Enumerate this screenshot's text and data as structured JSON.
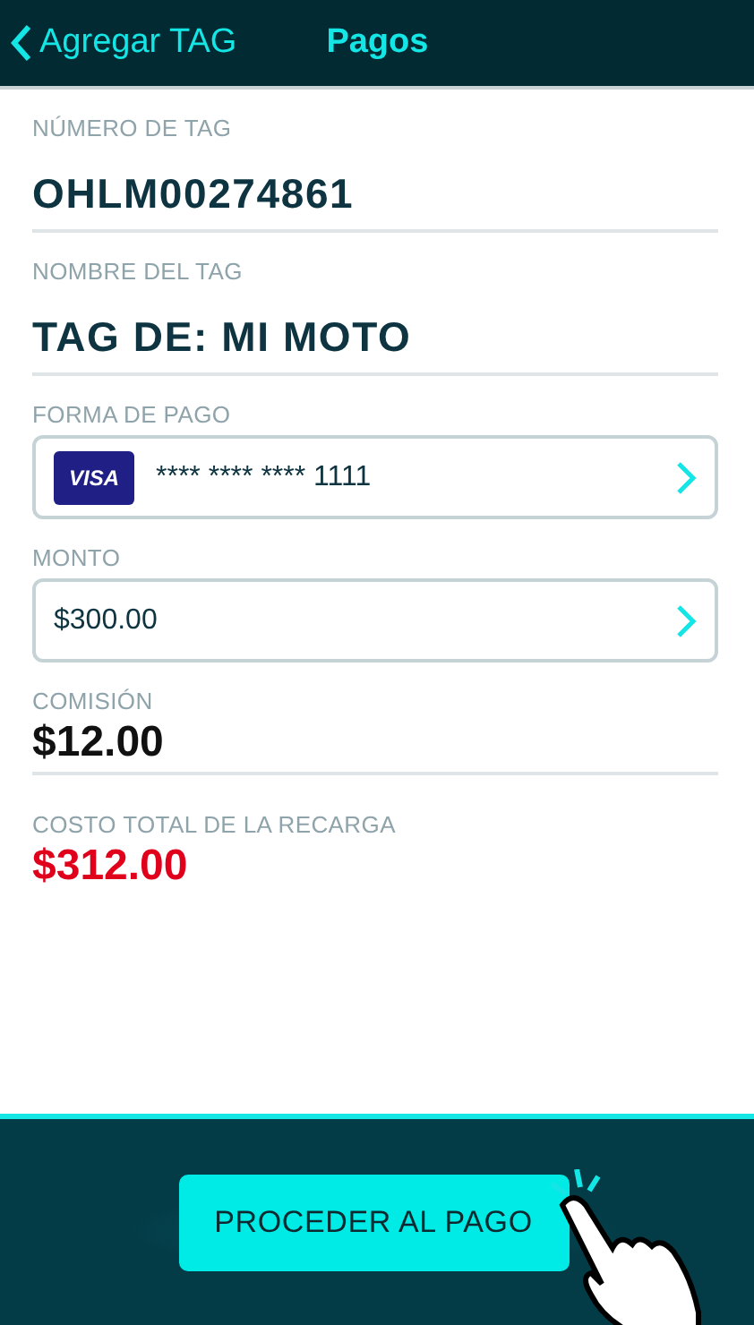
{
  "header": {
    "back_label": "Agregar TAG",
    "title": "Pagos"
  },
  "fields": [
    {
      "kind": "text",
      "label": "NÚMERO DE TAG",
      "value": "OHLM00274861"
    },
    {
      "kind": "text",
      "label": "NOMBRE DEL TAG",
      "value": "TAG DE: MI MOTO"
    },
    {
      "kind": "card",
      "label": "FORMA DE PAGO",
      "card_brand": "VISA",
      "value": "**** **** **** 1111"
    },
    {
      "kind": "select",
      "label": "MONTO",
      "value": "$300.00"
    },
    {
      "kind": "amount",
      "label": "COMISIÓN",
      "value": "$12.00"
    },
    {
      "kind": "total",
      "label": "COSTO TOTAL DE LA RECARGA",
      "value": "$312.00"
    }
  ],
  "button": {
    "label": "PROCEDER AL PAGO"
  }
}
